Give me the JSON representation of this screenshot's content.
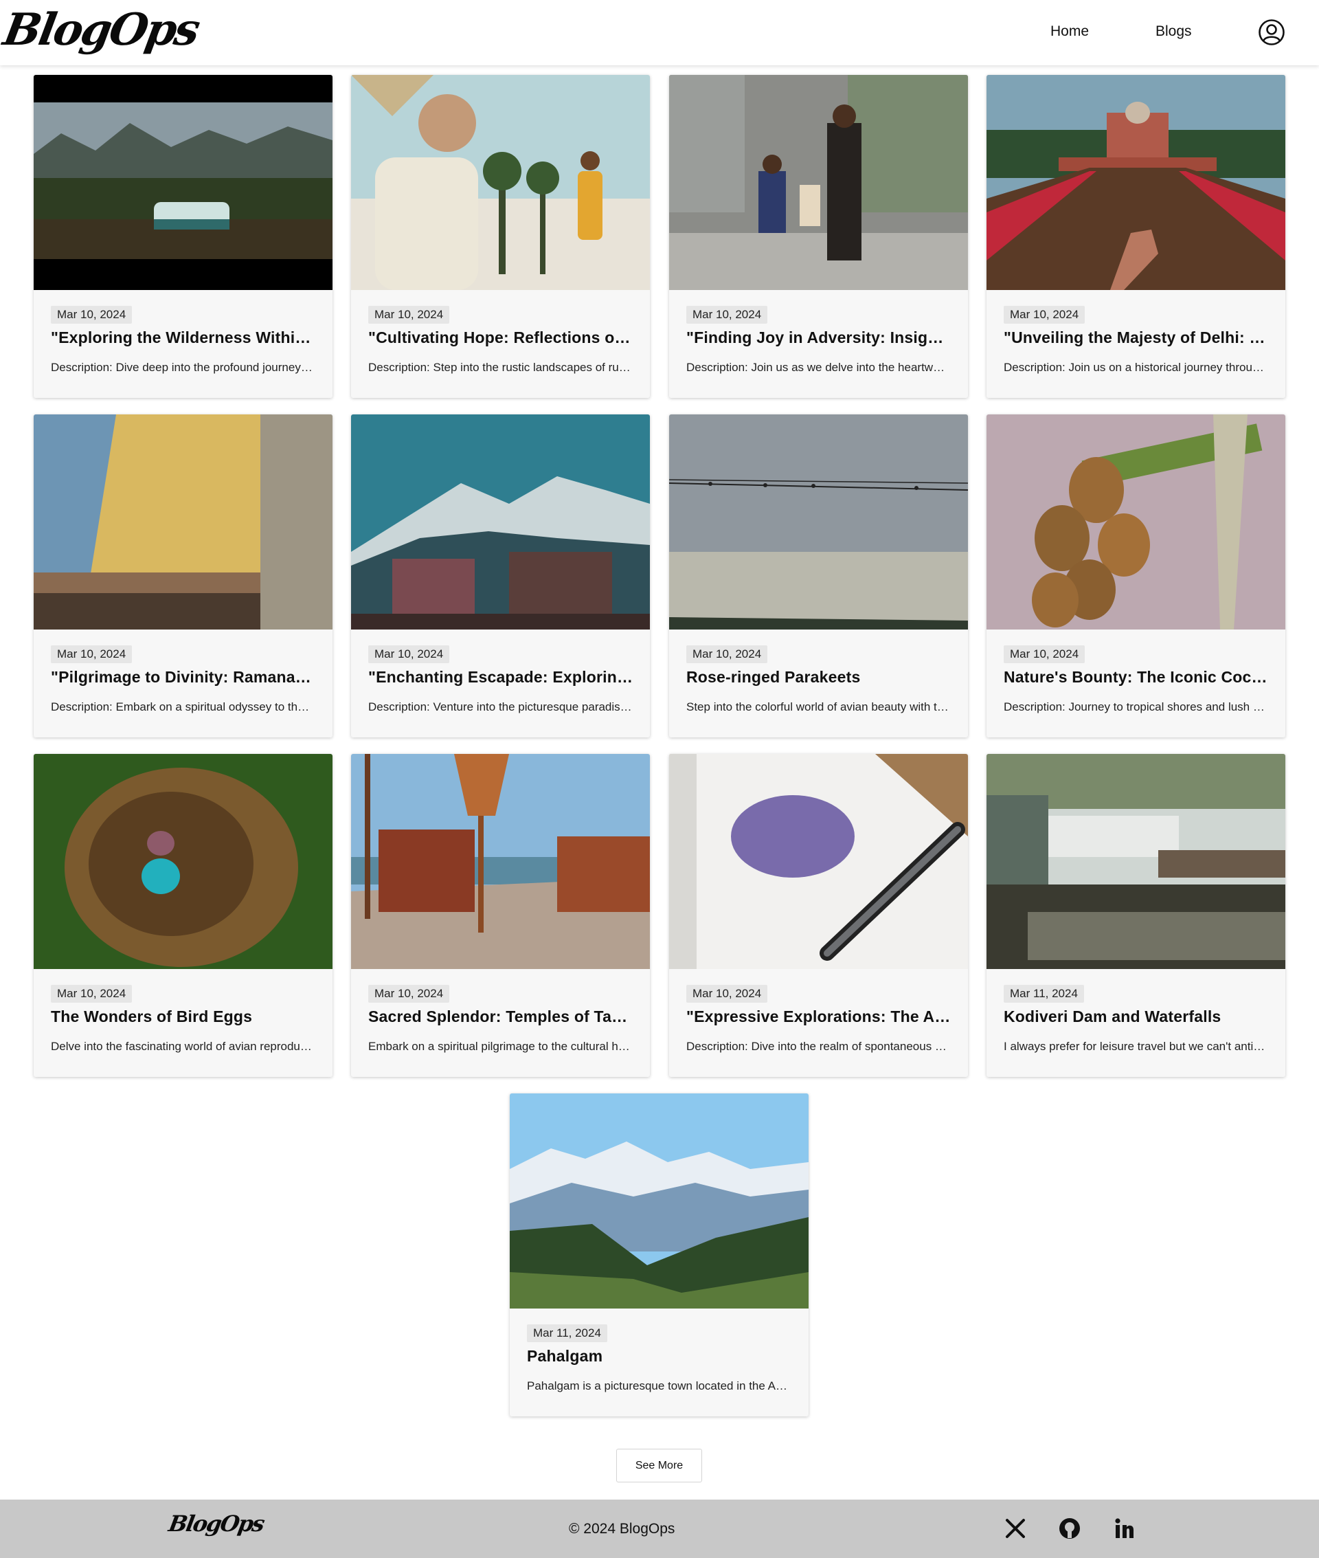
{
  "header": {
    "logo": "BlogOps",
    "nav": {
      "home": "Home",
      "blogs": "Blogs"
    },
    "profile_icon": "user-circle-icon"
  },
  "cards": [
    {
      "date": "Mar 10, 2024",
      "title": "\"Exploring the Wilderness Within: A Journey into the Heart of Nature\"",
      "description": "Description: Dive deep into the profound journey of self-discovery"
    },
    {
      "date": "Mar 10, 2024",
      "title": "\"Cultivating Hope: Reflections on Rural Life\"",
      "description": "Description: Step into the rustic landscapes of rural India"
    },
    {
      "date": "Mar 10, 2024",
      "title": "\"Finding Joy in Adversity: Insights from The Pursuit of Happyness\"",
      "description": "Description: Join us as we delve into the heartwarming story"
    },
    {
      "date": "Mar 10, 2024",
      "title": "\"Unveiling the Majesty of Delhi: Safdarjung Tomb\"",
      "description": "Description: Join us on a historical journey through the ages"
    },
    {
      "date": "Mar 10, 2024",
      "title": "\"Pilgrimage to Divinity: Ramanathaswamy Temple\"",
      "description": "Description: Embark on a spiritual odyssey to the sacred shores"
    },
    {
      "date": "Mar 10, 2024",
      "title": "\"Enchanting Escapade: Exploring the Himalayan Villages\"",
      "description": "Description: Venture into the picturesque paradise of the hills"
    },
    {
      "date": "Mar 10, 2024",
      "title": "Rose-ringed Parakeets",
      "description": "Step into the colorful world of avian beauty with these birds"
    },
    {
      "date": "Mar 10, 2024",
      "title": "Nature's Bounty: The Iconic Coconut Palm",
      "description": "Description: Journey to tropical shores and lush coastal lands"
    },
    {
      "date": "Mar 10, 2024",
      "title": "The Wonders of Bird Eggs",
      "description": "Delve into the fascinating world of avian reproduction and nests"
    },
    {
      "date": "Mar 10, 2024",
      "title": "Sacred Splendor: Temples of Tamil Nadu",
      "description": "Embark on a spiritual pilgrimage to the cultural heartland"
    },
    {
      "date": "Mar 10, 2024",
      "title": "\"Expressive Explorations: The Art of Abstract Doodling\"",
      "description": "Description: Dive into the realm of spontaneous creativity"
    },
    {
      "date": "Mar 11, 2024",
      "title": "Kodiveri Dam and Waterfalls",
      "description": "I always prefer for leisure travel but we can't anticipate every turn"
    },
    {
      "date": "Mar 11, 2024",
      "title": "Pahalgam",
      "description": "Pahalgam is a picturesque town located in the Anantnag district"
    }
  ],
  "see_more": "See More",
  "footer": {
    "logo": "BlogOps",
    "copyright": "© 2024 BlogOps",
    "social": [
      "x-icon",
      "github-icon",
      "linkedin-icon"
    ]
  }
}
